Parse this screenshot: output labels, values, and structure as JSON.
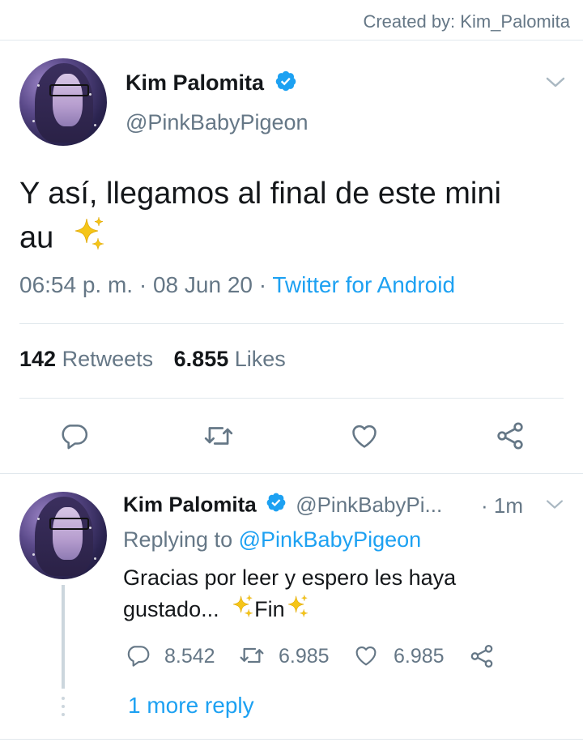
{
  "watermark": "Created by: Kim_Palomita",
  "main_tweet": {
    "display_name": "Kim Palomita",
    "handle": "@PinkBabyPigeon",
    "text": "Y así, llegamos al final de este mini au",
    "time": "06:54 p. m.",
    "separator1": "·",
    "date": "08 Jun 20",
    "separator2": "·",
    "source": "Twitter for Android",
    "retweets_count": "142",
    "retweets_label": "Retweets",
    "likes_count": "6.855",
    "likes_label": "Likes"
  },
  "reply": {
    "display_name": "Kim Palomita",
    "handle": "@PinkBabyPi...",
    "time": "· 1m",
    "replying_prefix": "Replying to",
    "replying_to": "@PinkBabyPigeon",
    "text_line1": "Gracias por leer y espero les haya",
    "text_line2_a": "gustado...",
    "text_line2_b": "Fin",
    "reply_count": "8.542",
    "retweet_count": "6.985",
    "like_count": "6.985",
    "more_replies": "1 more reply"
  },
  "colors": {
    "accent": "#1da1f2",
    "secondary_text": "#657786",
    "divider": "#e1e8ed",
    "sparkle": "#f5c518"
  },
  "icons": [
    "chevron-down-icon",
    "verified-badge-icon",
    "sparkles-icon",
    "reply-icon",
    "retweet-icon",
    "like-icon",
    "share-icon"
  ]
}
